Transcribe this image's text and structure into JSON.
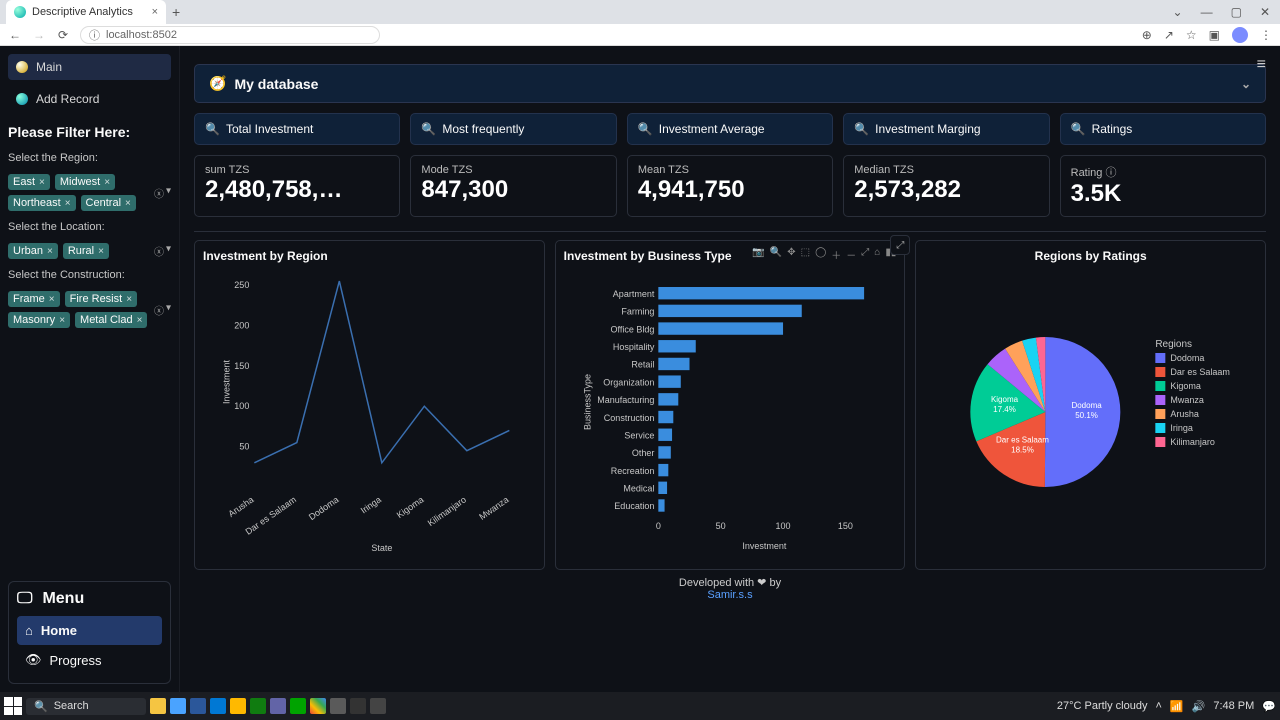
{
  "browser": {
    "tab_title": "Descriptive Analytics",
    "url": "localhost:8502"
  },
  "hamburger": "≡",
  "nav": {
    "main": "Main",
    "add": "Add Record"
  },
  "filter": {
    "title": "Please Filter Here:",
    "region_label": "Select the Region:",
    "regions": [
      "East",
      "Midwest",
      "Northeast",
      "Central"
    ],
    "location_label": "Select the Location:",
    "locations": [
      "Urban",
      "Rural"
    ],
    "construction_label": "Select the Construction:",
    "constructions": [
      "Frame",
      "Fire Resist",
      "Masonry",
      "Metal Clad"
    ]
  },
  "menu": {
    "title": "Menu",
    "home": "Home",
    "progress": "Progress"
  },
  "expander": {
    "title": "My database"
  },
  "header_cards": [
    "Total Investment",
    "Most frequently",
    "Investment Average",
    "Investment Marging",
    "Ratings"
  ],
  "metrics": [
    {
      "label": "sum TZS",
      "value": "2,480,758,…"
    },
    {
      "label": "Mode TZS",
      "value": "847,300"
    },
    {
      "label": "Mean TZS",
      "value": "4,941,750"
    },
    {
      "label": "Median TZS",
      "value": "2,573,282"
    },
    {
      "label": "Rating ⓘ",
      "value": "3.5K"
    }
  ],
  "chart_data": [
    {
      "type": "line",
      "title": "Investment by Region",
      "xlabel": "State",
      "ylabel": "Investment",
      "categories": [
        "Arusha",
        "Dar es Salaam",
        "Dodoma",
        "Iringa",
        "Kigoma",
        "Kilimanjaro",
        "Mwanza"
      ],
      "values": [
        30,
        55,
        255,
        30,
        100,
        45,
        70
      ],
      "ylim": [
        0,
        260
      ],
      "yticks": [
        50,
        100,
        150,
        200,
        250
      ]
    },
    {
      "type": "bar",
      "orientation": "h",
      "title": "Investment by Business Type",
      "xlabel": "Investment",
      "ylabel": "BusinessType",
      "categories": [
        "Apartment",
        "Farming",
        "Office Bldg",
        "Hospitality",
        "Retail",
        "Organization",
        "Manufacturing",
        "Construction",
        "Service",
        "Other",
        "Recreation",
        "Medical",
        "Education"
      ],
      "values": [
        165,
        115,
        100,
        30,
        25,
        18,
        16,
        12,
        11,
        10,
        8,
        7,
        5
      ],
      "xlim": [
        0,
        170
      ],
      "xticks": [
        0,
        50,
        100,
        150
      ]
    },
    {
      "type": "pie",
      "title": "Regions by Ratings",
      "legend_title": "Regions",
      "series": [
        {
          "name": "Dodoma",
          "value": 50.1,
          "color": "#636efa"
        },
        {
          "name": "Dar es Salaam",
          "value": 18.5,
          "color": "#ef553b"
        },
        {
          "name": "Kigoma",
          "value": 17.4,
          "color": "#00cc96"
        },
        {
          "name": "Mwanza",
          "value": 5.0,
          "color": "#ab63fa"
        },
        {
          "name": "Arusha",
          "value": 4.0,
          "color": "#ffa15a"
        },
        {
          "name": "Iringa",
          "value": 3.0,
          "color": "#19d3f3"
        },
        {
          "name": "Kilimanjaro",
          "value": 2.0,
          "color": "#ff6692"
        }
      ]
    }
  ],
  "footer": {
    "line1": "Developed with ❤ by",
    "line2": "Samir.s.s"
  },
  "taskbar": {
    "search": "Search",
    "weather": "27°C  Partly cloudy",
    "time": "7:48 PM"
  }
}
